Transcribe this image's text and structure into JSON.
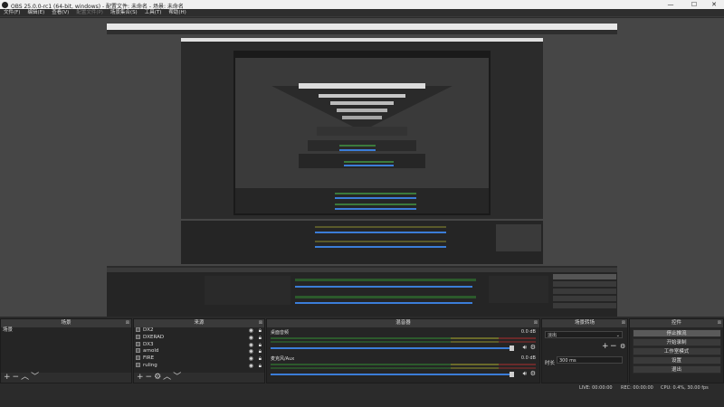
{
  "window": {
    "title": "OBS 25.0.0-rc1 (64-bit, windows) - 配置文件: 未命名 - 场景: 未命名"
  },
  "menu": [
    {
      "label": "文件(F)",
      "disabled": false
    },
    {
      "label": "编辑(E)",
      "disabled": false
    },
    {
      "label": "查看(V)",
      "disabled": false
    },
    {
      "label": "配置文件(P)",
      "disabled": true
    },
    {
      "label": "场景集合(S)",
      "disabled": false
    },
    {
      "label": "工具(T)",
      "disabled": false
    },
    {
      "label": "帮助(H)",
      "disabled": false
    }
  ],
  "panels": {
    "scenes": {
      "title": "场景",
      "items": [
        "场景"
      ]
    },
    "sources": {
      "title": "来源",
      "items": [
        "DX2",
        "DXERAD",
        "DX3",
        "arnold",
        "FIRE",
        "ruling"
      ]
    },
    "mixer": {
      "title": "混音器",
      "tracks": [
        {
          "name": "桌面音频",
          "db": "0.0 dB"
        },
        {
          "name": "麦克风/Aux",
          "db": "0.0 dB"
        }
      ]
    },
    "transitions": {
      "title": "场景转场",
      "type": "淡出",
      "duration_label": "时长",
      "duration": "300 ms"
    },
    "controls": {
      "title": "控件",
      "buttons": [
        "停止推流",
        "开始录制",
        "工作室模式",
        "设置",
        "退出"
      ]
    }
  },
  "status": {
    "live": "LIVE: 00:00:00",
    "rec": "REC: 00:00:00",
    "cpu": "CPU: 0.4%, 30.00 fps"
  },
  "colors": {
    "slider": "#3b7dd8",
    "background": "#2b2b2b",
    "preview": "#464646"
  }
}
